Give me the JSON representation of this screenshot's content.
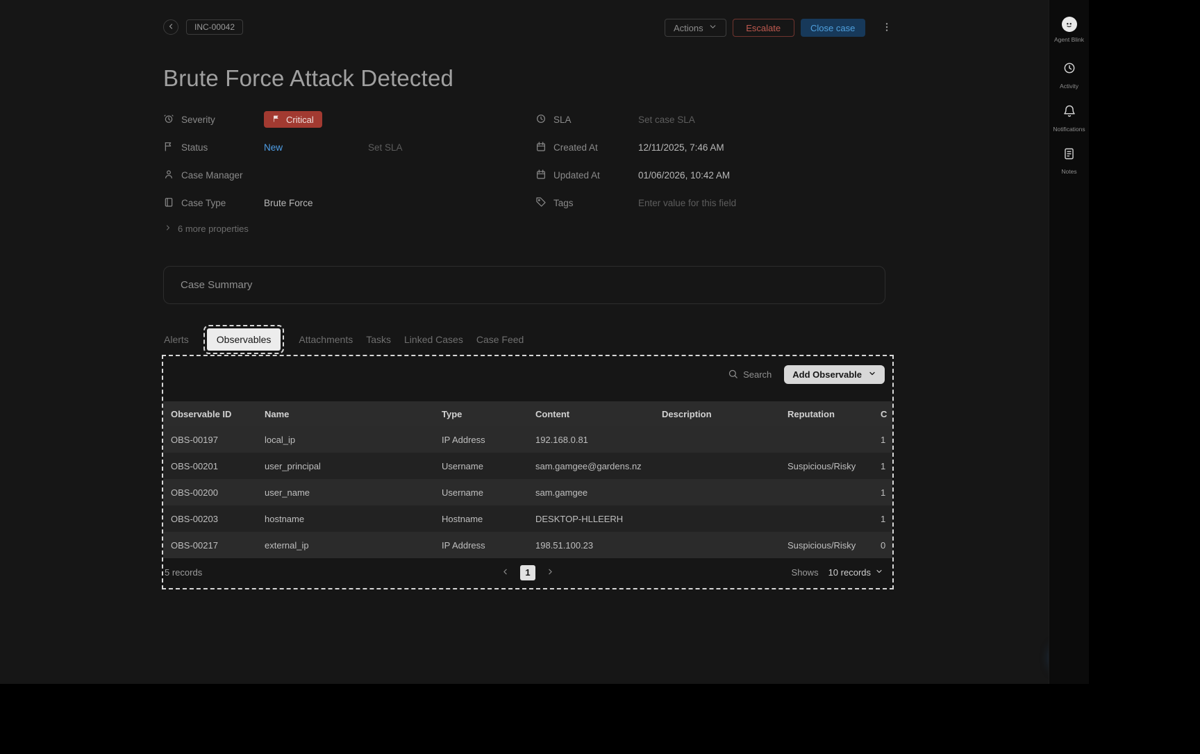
{
  "header": {
    "case_id": "INC-00042",
    "actions_label": "Actions",
    "escalate_label": "Escalate",
    "close_case_label": "Close case"
  },
  "title": "Brute Force Attack Detected",
  "properties": {
    "left": [
      {
        "icon": "severity-alarm-icon",
        "label": "Severity",
        "value": "Critical"
      },
      {
        "icon": "flag-icon",
        "label": "Status",
        "value": "New",
        "extra": "Set SLA"
      },
      {
        "icon": "user-icon",
        "label": "Case Manager",
        "value": ""
      },
      {
        "icon": "case-type-icon",
        "label": "Case Type",
        "value": "Brute Force"
      }
    ],
    "right": [
      {
        "icon": "clock-icon",
        "label": "SLA",
        "value": "Set case SLA"
      },
      {
        "icon": "calendar-icon",
        "label": "Created At",
        "value": "12/11/2025, 7:46 AM"
      },
      {
        "icon": "calendar-icon",
        "label": "Updated At",
        "value": "01/06/2026, 10:42 AM"
      },
      {
        "icon": "tag-icon",
        "label": "Tags",
        "value": "Enter value for this field"
      }
    ],
    "more_label": "6 more properties"
  },
  "summary": {
    "title": "Case Summary"
  },
  "tabs": [
    "Alerts",
    "Observables",
    "Attachments",
    "Tasks",
    "Linked Cases",
    "Case Feed"
  ],
  "active_tab": "Observables",
  "observables": {
    "search_label": "Search",
    "add_button_label": "Add Observable",
    "columns": [
      "Observable ID",
      "Name",
      "Type",
      "Content",
      "Description",
      "Reputation",
      "C"
    ],
    "rows": [
      [
        "OBS-00197",
        "local_ip",
        "IP Address",
        "192.168.0.81",
        "",
        "",
        "1"
      ],
      [
        "OBS-00201",
        "user_principal",
        "Username",
        "sam.gamgee@gardens.nz",
        "",
        "Suspicious/Risky",
        "1"
      ],
      [
        "OBS-00200",
        "user_name",
        "Username",
        "sam.gamgee",
        "",
        "",
        "1"
      ],
      [
        "OBS-00203",
        "hostname",
        "Hostname",
        "DESKTOP-HLLEERH",
        "",
        "",
        "1"
      ],
      [
        "OBS-00217",
        "external_ip",
        "IP Address",
        "198.51.100.23",
        "",
        "Suspicious/Risky",
        "0"
      ]
    ],
    "footer": {
      "records_label": "5 records",
      "page": "1",
      "shows_label": "Shows",
      "page_size_label": "10 records"
    }
  },
  "rail": {
    "items": [
      {
        "icon": "agent-avatar-icon",
        "label": "Agent Blink"
      },
      {
        "icon": "activity-clock-icon",
        "label": "Activity"
      },
      {
        "icon": "notifications-bell-icon",
        "label": "Notifications"
      },
      {
        "icon": "notes-icon",
        "label": "Notes"
      }
    ]
  },
  "colors": {
    "critical_red": "#a23a31",
    "status_blue": "#4f9fe8",
    "close_case_blue": "#17395a",
    "fab_blue": "#2e73bd"
  }
}
